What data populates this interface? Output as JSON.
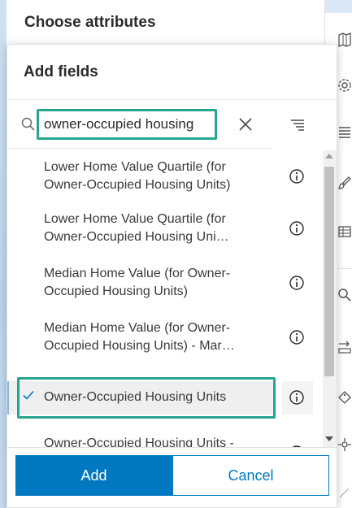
{
  "background_panel": {
    "title": "Choose attributes"
  },
  "dialog": {
    "title": "Add fields",
    "search": {
      "value": "owner-occupied housing",
      "clear_icon": "close-icon",
      "sort_icon": "sort-lines-icon"
    },
    "items": [
      {
        "line1": "Lower Home Value Quartile (for",
        "line2": "Owner-Occupied Housing Units)",
        "selected": false
      },
      {
        "line1": "Lower Home Value Quartile (for",
        "line2": "Owner-Occupied Housing Uni…",
        "selected": false
      },
      {
        "line1": "Median Home Value (for Owner-",
        "line2": "Occupied Housing Units)",
        "selected": false
      },
      {
        "line1": "Median Home Value (for Owner-",
        "line2": "Occupied Housing Units) - Mar…",
        "selected": false
      },
      {
        "line1": "Owner-Occupied Housing Units",
        "line2": "",
        "selected": true
      },
      {
        "line1": "Owner-Occupied Housing Units -",
        "line2": "",
        "selected": false
      }
    ],
    "buttons": {
      "add": "Add",
      "cancel": "Cancel"
    }
  },
  "colors": {
    "accent": "#0079c1",
    "highlight": "#26a58f",
    "selected_bg": "#efefef"
  },
  "right_toolbar": {
    "icons": [
      "map-icon",
      "settings-icon",
      "legend-icon",
      "brush-icon",
      "table-icon",
      "search-icon",
      "measure-icon",
      "tag-icon",
      "locate-icon",
      "collapse-icon"
    ]
  }
}
